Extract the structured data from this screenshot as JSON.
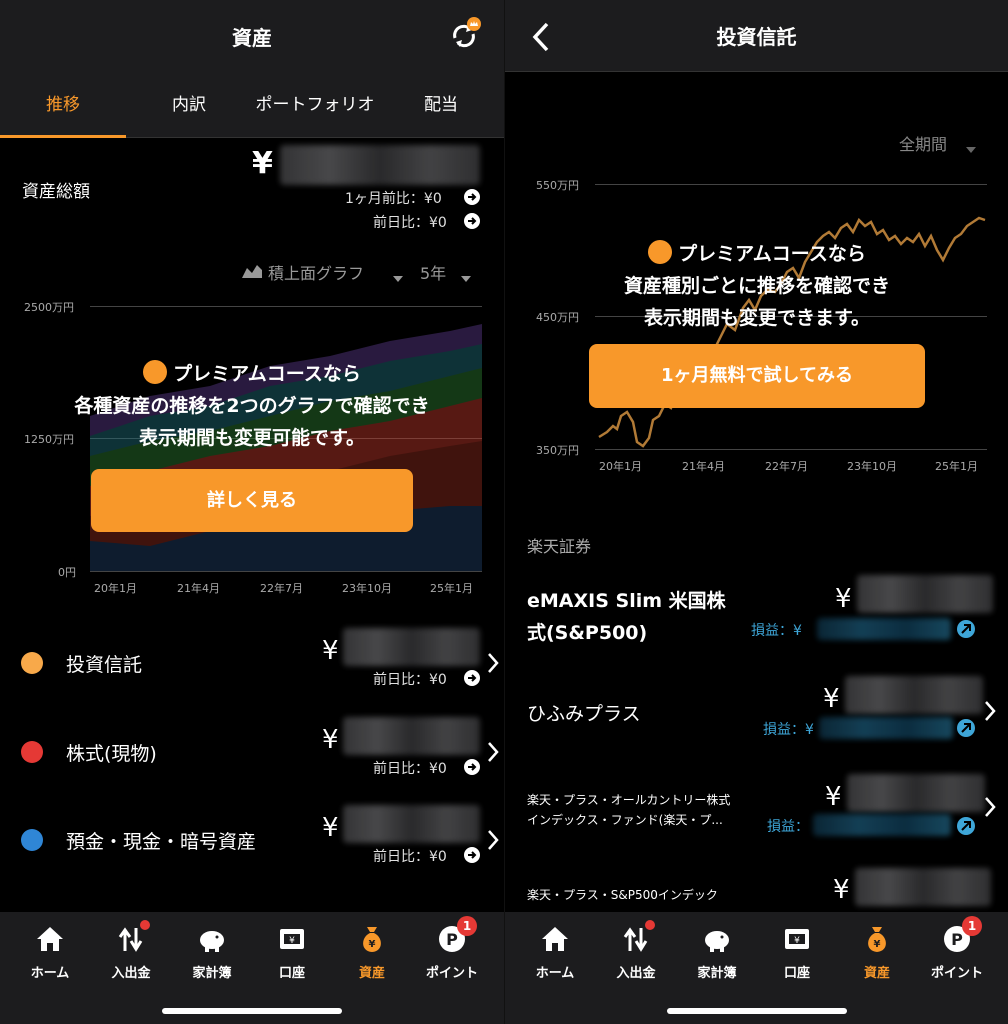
{
  "left": {
    "header": {
      "title": "資産"
    },
    "tabs": [
      {
        "label": "推移",
        "active": true
      },
      {
        "label": "内訳",
        "active": false
      },
      {
        "label": "ポートフォリオ",
        "active": false
      },
      {
        "label": "配当",
        "active": false
      }
    ],
    "summary": {
      "label": "資産総額",
      "currency": "¥",
      "month_compare": "1ヶ月前比：¥0",
      "day_compare": "前日比：¥0"
    },
    "chart_controls": {
      "type_label": "積上面グラフ",
      "period_label": "5年"
    },
    "chart_data": {
      "type": "area",
      "y_ticks": [
        "2500万円",
        "1250万円",
        "0円"
      ],
      "x_ticks": [
        "20年1月",
        "21年4月",
        "22年7月",
        "23年10月",
        "25年1月"
      ]
    },
    "promo": {
      "lines": [
        "プレミアムコースなら",
        "各種資産の推移を2つのグラフで確認でき",
        "表示期間も変更可能です。"
      ],
      "button": "詳しく見る"
    },
    "assets": [
      {
        "name": "投資信託",
        "color": "#f8a94a",
        "currency": "¥",
        "day_compare": "前日比：¥0"
      },
      {
        "name": "株式(現物)",
        "color": "#e53935",
        "currency": "¥",
        "day_compare": "前日比：¥0"
      },
      {
        "name": "預金・現金・暗号資産",
        "color": "#2f86d6",
        "currency": "¥",
        "day_compare": "前日比：¥0"
      }
    ]
  },
  "right": {
    "header": {
      "title": "投資信託"
    },
    "period_select": "全期間",
    "chart_data": {
      "type": "line",
      "y_ticks": [
        "550万円",
        "450万円",
        "350万円"
      ],
      "x_ticks": [
        "20年1月",
        "21年4月",
        "22年7月",
        "23年10月",
        "25年1月"
      ]
    },
    "promo": {
      "lines": [
        "プレミアムコースなら",
        "資産種別ごとに推移を確認でき",
        "表示期間も変更できます。"
      ],
      "button": "1ヶ月無料で試してみる"
    },
    "broker": "楽天証券",
    "funds": [
      {
        "name_lines": [
          "eMAXIS Slim 米国株",
          "式(S&P500)"
        ],
        "currency": "¥",
        "pl_label": "損益：¥"
      },
      {
        "name_lines": [
          "ひふみプラス"
        ],
        "currency": "¥",
        "pl_label": "損益：¥"
      },
      {
        "name_lines": [
          "楽天・プラス・オールカントリー株式",
          "インデックス・ファンド(楽天・プ..."
        ],
        "currency": "¥",
        "pl_label": "損益："
      },
      {
        "name_lines": [
          "楽天・プラス・S&P500インデック"
        ],
        "currency": "¥"
      }
    ]
  },
  "nav": [
    {
      "label": "ホーム",
      "icon": "home-icon"
    },
    {
      "label": "入出金",
      "icon": "transfer-icon",
      "dot": true
    },
    {
      "label": "家計簿",
      "icon": "piggy-bank-icon"
    },
    {
      "label": "口座",
      "icon": "account-icon"
    },
    {
      "label": "資産",
      "icon": "money-bag-icon",
      "active": true
    },
    {
      "label": "ポイント",
      "icon": "points-icon",
      "badge": "1"
    }
  ]
}
